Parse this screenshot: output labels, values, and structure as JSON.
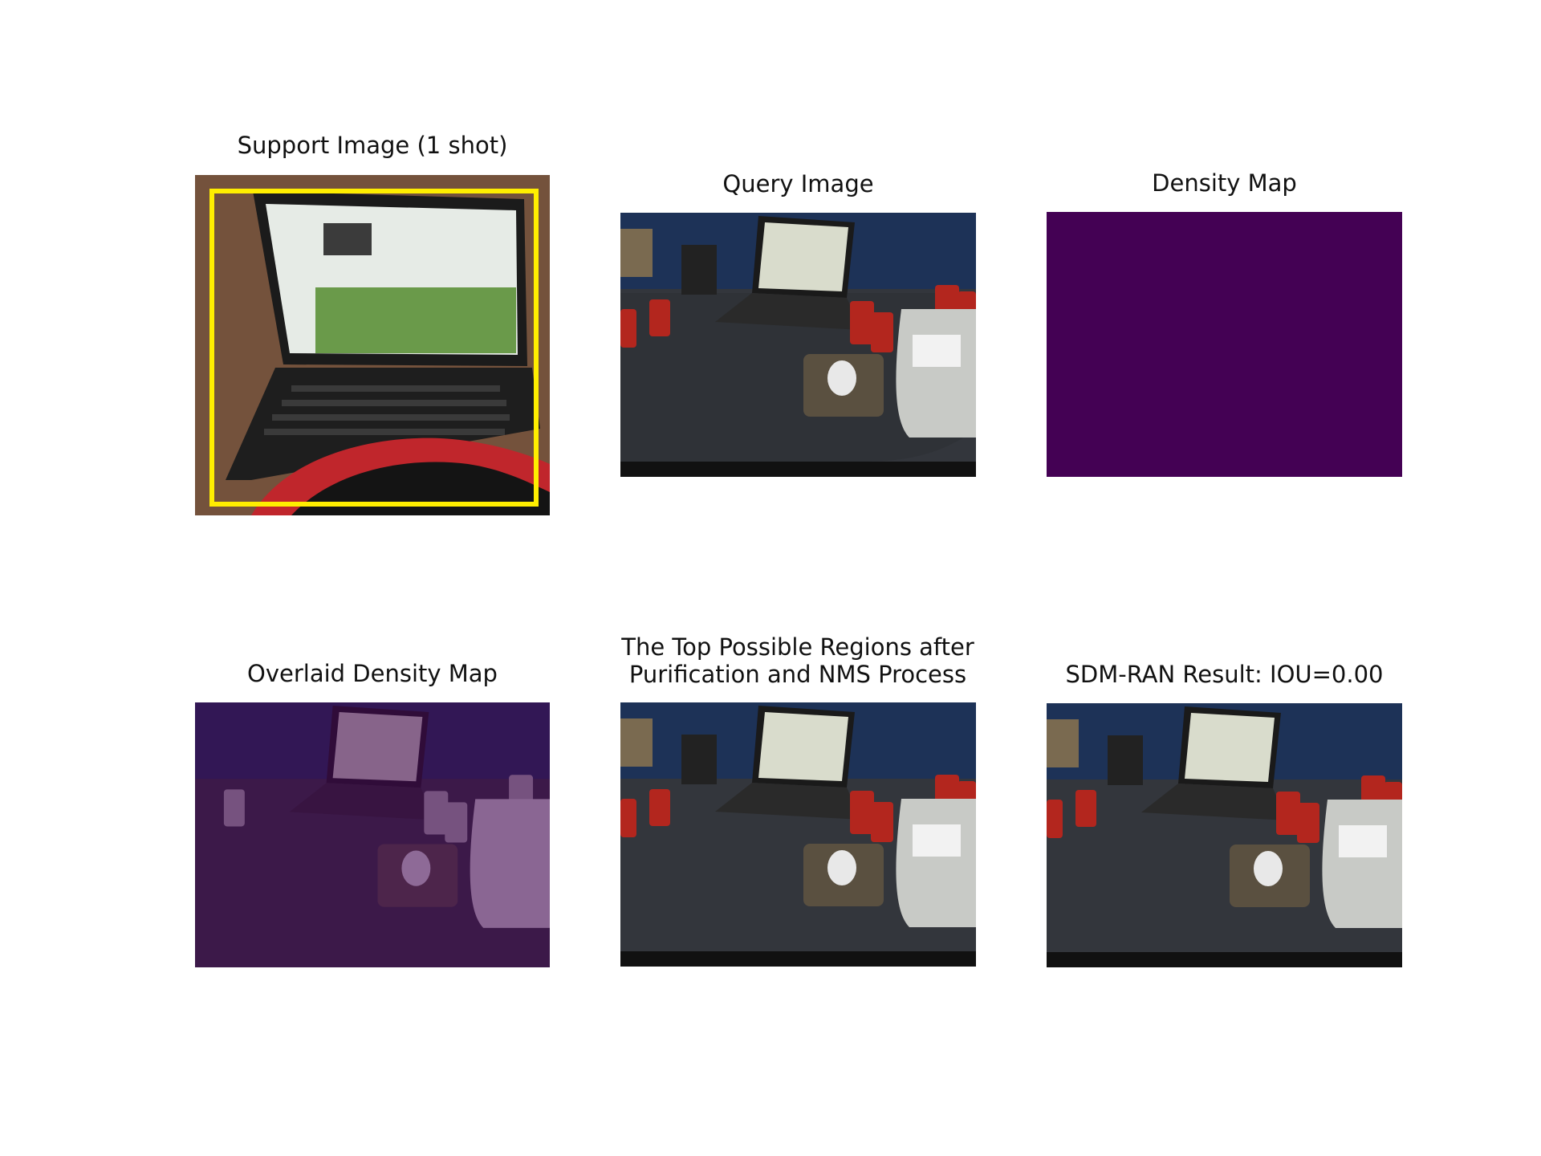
{
  "figure": {
    "panels": [
      {
        "id": "support",
        "title": "Support Image (1 shot)"
      },
      {
        "id": "query",
        "title": "Query Image"
      },
      {
        "id": "density",
        "title": "Density Map"
      },
      {
        "id": "overlaid",
        "title": "Overlaid Density Map"
      },
      {
        "id": "regions",
        "title": "The Top Possible Regions after Purification and NMS Process"
      },
      {
        "id": "result",
        "title": "SDM-RAN Result: IOU=0.00"
      }
    ],
    "colors": {
      "support_box": "#ffee00",
      "density_fill": "#440154"
    }
  }
}
